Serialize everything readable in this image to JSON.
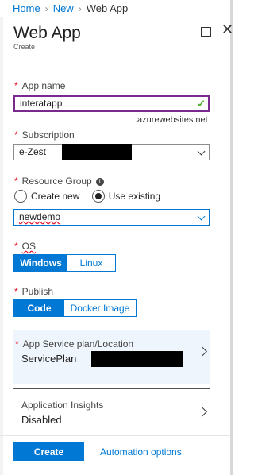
{
  "breadcrumb": {
    "items": [
      "Home",
      "New",
      "Web App"
    ]
  },
  "blade": {
    "title": "Web App",
    "subtitle": "Create"
  },
  "form": {
    "required_mark": "*",
    "app_name": {
      "label": "App name",
      "value": "interatapp",
      "suffix": ".azurewebsites.net"
    },
    "subscription": {
      "label": "Subscription",
      "value": "e-Zest"
    },
    "resource_group": {
      "label": "Resource Group",
      "options": [
        "Create new",
        "Use existing"
      ],
      "selected": "Use existing",
      "value": "newdemo"
    },
    "os": {
      "label": "OS",
      "options": [
        "Windows",
        "Linux"
      ],
      "selected": "Windows"
    },
    "publish": {
      "label": "Publish",
      "options": [
        "Code",
        "Docker Image"
      ],
      "selected": "Code"
    },
    "service_plan": {
      "label": "App Service plan/Location",
      "value": "ServicePlan"
    },
    "insights": {
      "label": "Application Insights",
      "value": "Disabled"
    }
  },
  "footer": {
    "create_label": "Create",
    "automation_label": "Automation options"
  },
  "colors": {
    "accent": "#0078d4",
    "required": "#e81123",
    "valid": "#4caf2a"
  }
}
